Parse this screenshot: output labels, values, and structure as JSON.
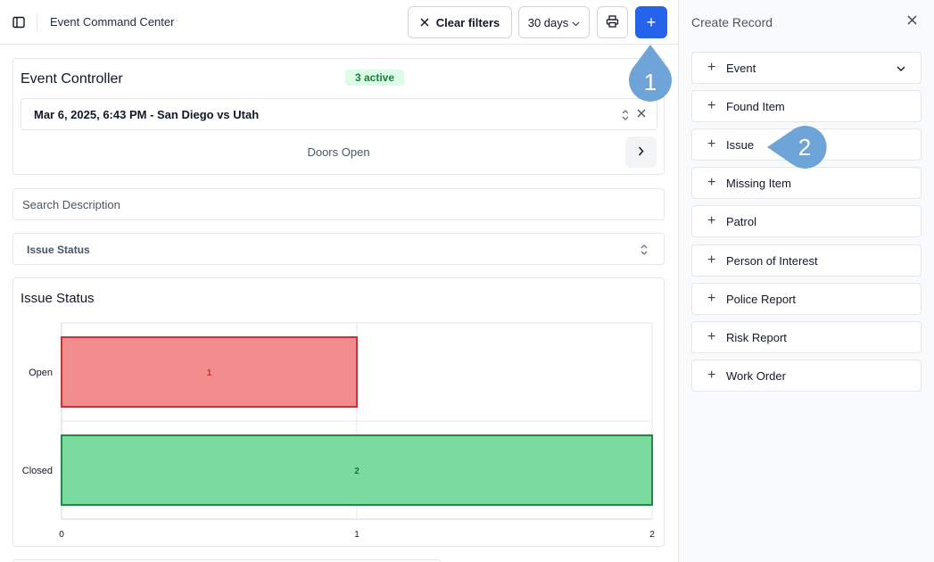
{
  "topbar": {
    "title": "Event Command Center",
    "clear_filters_label": "Clear filters",
    "date_range": "30 days",
    "add_label": "+"
  },
  "event_controller": {
    "title": "Event Controller",
    "active_badge": "3 active",
    "selected_event": "Mar 6, 2025, 6:43 PM - San Diego vs Utah",
    "phase_label": "Doors Open"
  },
  "search": {
    "placeholder": "Search Description"
  },
  "status_filter": {
    "label": "Issue Status"
  },
  "chart_card": {
    "title": "Issue Status"
  },
  "chart_data": {
    "type": "bar",
    "orientation": "horizontal",
    "title": "Issue Status",
    "categories": [
      "Open",
      "Closed"
    ],
    "values": [
      1,
      2
    ],
    "data_labels": [
      "1",
      "2"
    ],
    "colors": [
      {
        "fill": "#f28b8b",
        "stroke": "#c8323a",
        "label": "#c8323a"
      },
      {
        "fill": "#7adb9e",
        "stroke": "#1f8a45",
        "label": "#1f6f3a"
      }
    ],
    "xlim": [
      0,
      2
    ],
    "x_ticks": [
      "0",
      "1",
      "2"
    ],
    "grid": true
  },
  "panel": {
    "title": "Create Record",
    "items": [
      {
        "label": "Event"
      },
      {
        "label": "Found Item"
      },
      {
        "label": "Issue"
      },
      {
        "label": "Missing Item"
      },
      {
        "label": "Patrol"
      },
      {
        "label": "Person of Interest"
      },
      {
        "label": "Police Report"
      },
      {
        "label": "Risk Report"
      },
      {
        "label": "Work Order"
      }
    ]
  },
  "callouts": {
    "first": "1",
    "second": "2"
  },
  "colors": {
    "accent": "#2563eb",
    "callout": "#6fa4d9",
    "badge_bg": "#dcfce7",
    "badge_text": "#15803d"
  }
}
